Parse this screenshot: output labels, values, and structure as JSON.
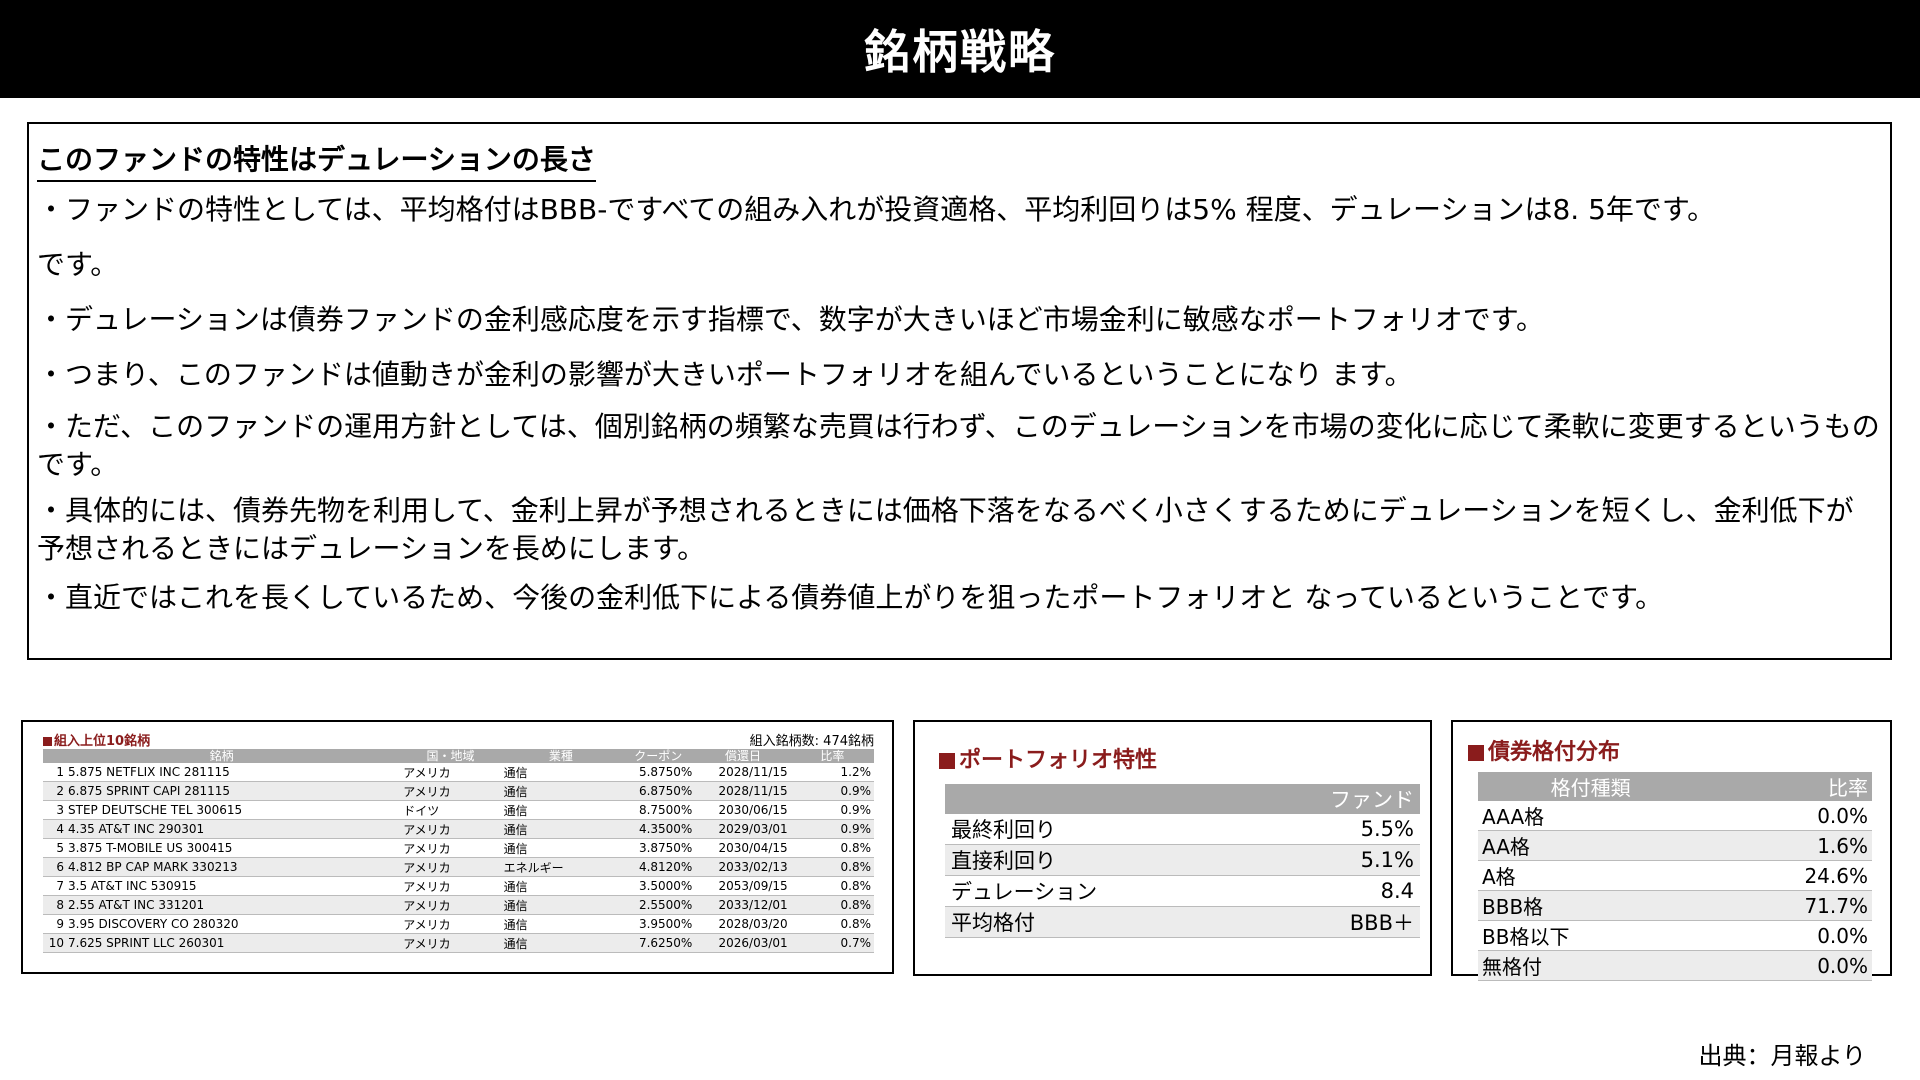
{
  "page_title": "銘柄戦略",
  "summary": {
    "heading": "このファンドの特性はデュレーションの長さ",
    "paragraphs": [
      "・ファンドの特性としては、平均格付はBBB-ですべての組み入れが投資適格、平均利回りは5% 程度、デュレーションは8. 5年です。",
      "です。",
      "・デュレーションは債券ファンドの金利感応度を示す指標で、数字が大きいほど市場金利に敏感なポートフォリオです。",
      "・つまり、このファンドは値動きが金利の影響が大きいポートフォリオを組んでいるということになり ます。",
      "・ただ、このファンドの運用方針としては、個別銘柄の頻繁な売買は行わず、このデュレーションを市場の変化に応じて柔軟に変更するというものです。",
      "・具体的には、債券先物を利用して、金利上昇が予想されるときには価格下落をなるべく小さくするためにデュレーションを短くし、金利低下が予想されるときにはデュレーションを長めにします。",
      "・直近ではこれを長くしているため、今後の金利低下による債券値上がりを狙ったポートフォリオと なっているということです。"
    ]
  },
  "holdings": {
    "title": "組入上位10銘柄",
    "count_label": "組入銘柄数: 474銘柄",
    "columns": [
      "銘柄",
      "国・地域",
      "業種",
      "クーポン",
      "償還日",
      "比率"
    ],
    "rows": [
      {
        "no": "1",
        "name": "5.875 NETFLIX INC 281115",
        "country": "アメリカ",
        "sector": "通信",
        "coupon": "5.8750%",
        "maturity": "2028/11/15",
        "weight": "1.2%"
      },
      {
        "no": "2",
        "name": "6.875 SPRINT CAPI 281115",
        "country": "アメリカ",
        "sector": "通信",
        "coupon": "6.8750%",
        "maturity": "2028/11/15",
        "weight": "0.9%"
      },
      {
        "no": "3",
        "name": "STEP DEUTSCHE TEL 300615",
        "country": "ドイツ",
        "sector": "通信",
        "coupon": "8.7500%",
        "maturity": "2030/06/15",
        "weight": "0.9%"
      },
      {
        "no": "4",
        "name": "4.35 AT&T INC 290301",
        "country": "アメリカ",
        "sector": "通信",
        "coupon": "4.3500%",
        "maturity": "2029/03/01",
        "weight": "0.9%"
      },
      {
        "no": "5",
        "name": "3.875 T-MOBILE US 300415",
        "country": "アメリカ",
        "sector": "通信",
        "coupon": "3.8750%",
        "maturity": "2030/04/15",
        "weight": "0.8%"
      },
      {
        "no": "6",
        "name": "4.812 BP CAP MARK 330213",
        "country": "アメリカ",
        "sector": "エネルギー",
        "coupon": "4.8120%",
        "maturity": "2033/02/13",
        "weight": "0.8%"
      },
      {
        "no": "7",
        "name": "3.5 AT&T INC 530915",
        "country": "アメリカ",
        "sector": "通信",
        "coupon": "3.5000%",
        "maturity": "2053/09/15",
        "weight": "0.8%"
      },
      {
        "no": "8",
        "name": "2.55 AT&T INC 331201",
        "country": "アメリカ",
        "sector": "通信",
        "coupon": "2.5500%",
        "maturity": "2033/12/01",
        "weight": "0.8%"
      },
      {
        "no": "9",
        "name": "3.95 DISCOVERY CO 280320",
        "country": "アメリカ",
        "sector": "通信",
        "coupon": "3.9500%",
        "maturity": "2028/03/20",
        "weight": "0.8%"
      },
      {
        "no": "10",
        "name": "7.625 SPRINT LLC 260301",
        "country": "アメリカ",
        "sector": "通信",
        "coupon": "7.6250%",
        "maturity": "2026/03/01",
        "weight": "0.7%"
      }
    ]
  },
  "portfolio": {
    "title": "ポートフォリオ特性",
    "column": "ファンド",
    "rows": [
      {
        "label": "最終利回り",
        "value": "5.5%"
      },
      {
        "label": "直接利回り",
        "value": "5.1%"
      },
      {
        "label": "デュレーション",
        "value": "8.4"
      },
      {
        "label": "平均格付",
        "value": "BBB＋"
      }
    ]
  },
  "ratings": {
    "title": "債券格付分布",
    "columns": [
      "格付種類",
      "比率"
    ],
    "rows": [
      {
        "label": "AAA格",
        "value": "0.0%"
      },
      {
        "label": "AA格",
        "value": "1.6%"
      },
      {
        "label": "A格",
        "value": "24.6%"
      },
      {
        "label": "BBB格",
        "value": "71.7%"
      },
      {
        "label": "BB格以下",
        "value": "0.0%"
      },
      {
        "label": "無格付",
        "value": "0.0%"
      }
    ]
  },
  "source": "出典：月報より",
  "colors": {
    "section_title": "#8a1c1c",
    "header_bg": "#a9a9a9",
    "title_bar": "#000000"
  }
}
